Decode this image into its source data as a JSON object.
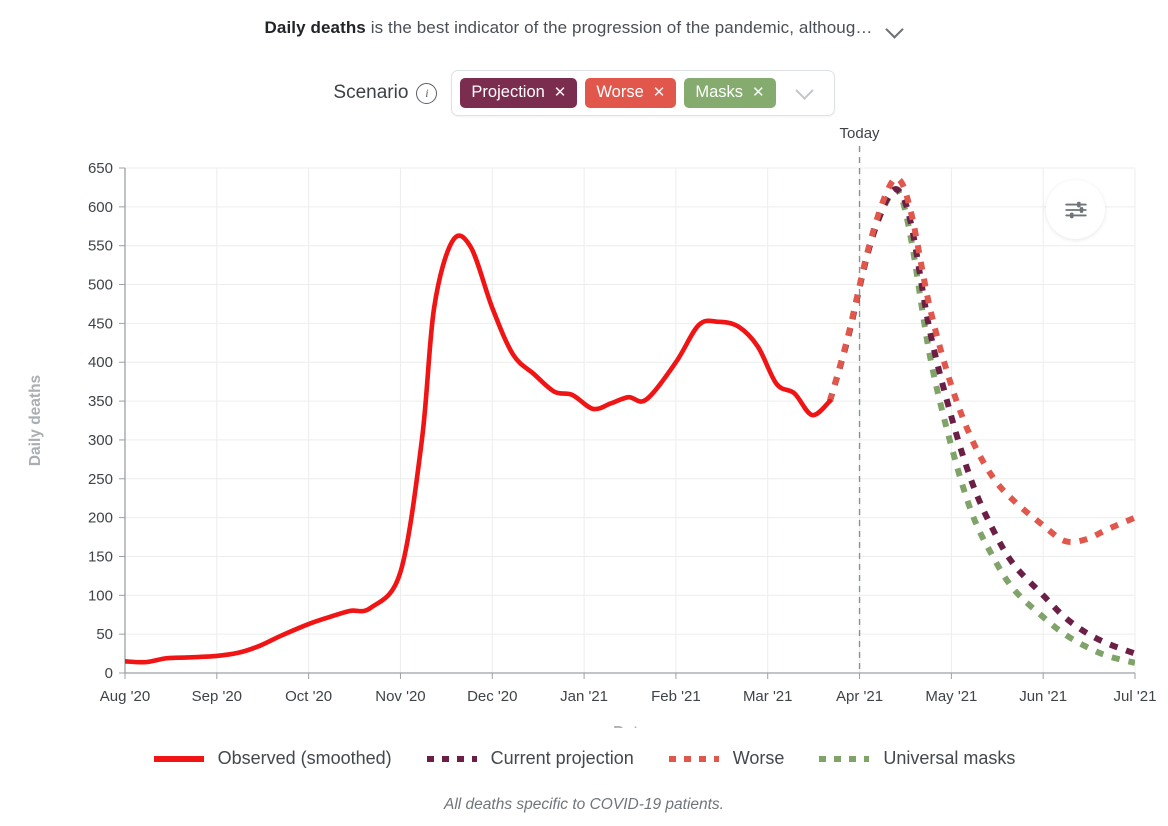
{
  "header": {
    "title_bold": "Daily deaths",
    "title_rest": " is the best indicator of the progression of the pandemic, althoug…",
    "expand_icon": "chevron-down-icon"
  },
  "scenario": {
    "label": "Scenario",
    "info_icon": "info-icon",
    "info_glyph": "i",
    "dropdown_icon": "chevron-down-icon",
    "tags": [
      {
        "label": "Projection",
        "color": "#7b2d50",
        "remove_icon": "close-icon",
        "remove_glyph": "✕"
      },
      {
        "label": "Worse",
        "color": "#e2574c",
        "remove_icon": "close-icon",
        "remove_glyph": "✕"
      },
      {
        "label": "Masks",
        "color": "#85ab6e",
        "remove_icon": "close-icon",
        "remove_glyph": "✕"
      }
    ]
  },
  "toolbar": {
    "settings_icon": "sliders-icon",
    "settings_label": "Chart settings"
  },
  "legend": [
    {
      "label": "Observed (smoothed)",
      "color": "#f01414",
      "style": "solid"
    },
    {
      "label": "Current projection",
      "color": "#6b1f45",
      "style": "dashed"
    },
    {
      "label": "Worse",
      "color": "#e2574c",
      "style": "dashed"
    },
    {
      "label": "Universal masks",
      "color": "#7fa368",
      "style": "dashed"
    }
  ],
  "footnote": "All deaths specific to COVID-19 patients.",
  "chart_data": {
    "type": "line",
    "title": "Daily deaths",
    "xlabel": "Date",
    "ylabel": "Daily deaths",
    "ylim": [
      0,
      650
    ],
    "ytick_step": 50,
    "ytick_labels": [
      "0",
      "50",
      "100",
      "150",
      "200",
      "250",
      "300",
      "350",
      "400",
      "450",
      "500",
      "550",
      "600",
      "650"
    ],
    "xtick_labels": [
      "Aug '20",
      "Sep '20",
      "Oct '20",
      "Nov '20",
      "Dec '20",
      "Jan '21",
      "Feb '21",
      "Mar '21",
      "Apr '21",
      "May '21",
      "Jun '21",
      "Jul '21"
    ],
    "xlim": [
      "Aug '20",
      "Jul '21"
    ],
    "grid": true,
    "legend_position": "bottom",
    "annotations": [
      {
        "name": "today-marker",
        "label": "Today",
        "x": "2021-04-01",
        "style": "dashed-vertical"
      }
    ],
    "series": [
      {
        "name": "Observed (smoothed)",
        "color": "#f01414",
        "style": "solid",
        "x": [
          "Aug 1",
          "Aug 8",
          "Aug 15",
          "Aug 22",
          "Sep 1",
          "Sep 8",
          "Sep 15",
          "Sep 22",
          "Oct 1",
          "Oct 8",
          "Oct 15",
          "Oct 22",
          "Nov 1",
          "Nov 8",
          "Nov 12",
          "Nov 18",
          "Nov 24",
          "Dec 1",
          "Dec 8",
          "Dec 15",
          "Dec 22",
          "Dec 28",
          "Jan 4",
          "Jan 10",
          "Jan 16",
          "Jan 22",
          "Feb 1",
          "Feb 8",
          "Feb 14",
          "Feb 20",
          "Feb 26",
          "Mar 4",
          "Mar 10",
          "Mar 16",
          "Mar 22"
        ],
        "values": [
          15,
          14,
          19,
          20,
          22,
          26,
          35,
          48,
          63,
          72,
          80,
          84,
          130,
          300,
          470,
          556,
          548,
          470,
          410,
          385,
          362,
          358,
          340,
          347,
          355,
          352,
          400,
          448,
          452,
          446,
          420,
          372,
          360,
          332,
          350
        ]
      },
      {
        "name": "Current projection",
        "color": "#6b1f45",
        "style": "dashed",
        "x": [
          "Mar 22",
          "Mar 28",
          "Apr 4",
          "Apr 10",
          "Apr 14",
          "Apr 18",
          "Apr 24",
          "May 1",
          "May 8",
          "May 15",
          "May 22",
          "Jun 1",
          "Jun 8",
          "Jun 15",
          "Jun 22",
          "Jul 1"
        ],
        "values": [
          350,
          430,
          545,
          610,
          620,
          575,
          440,
          330,
          245,
          185,
          140,
          100,
          72,
          52,
          38,
          25
        ]
      },
      {
        "name": "Worse",
        "color": "#e2574c",
        "style": "dashed",
        "x": [
          "Mar 22",
          "Mar 28",
          "Apr 4",
          "Apr 10",
          "Apr 14",
          "Apr 18",
          "Apr 24",
          "May 1",
          "May 8",
          "May 15",
          "May 22",
          "Jun 1",
          "Jun 8",
          "Jun 15",
          "Jun 22",
          "Jul 1"
        ],
        "values": [
          350,
          432,
          548,
          620,
          635,
          590,
          470,
          370,
          300,
          252,
          222,
          190,
          170,
          172,
          185,
          200
        ]
      },
      {
        "name": "Universal masks",
        "color": "#7fa368",
        "style": "dashed",
        "x": [
          "Mar 22",
          "Mar 28",
          "Apr 4",
          "Apr 10",
          "Apr 14",
          "Apr 18",
          "Apr 24",
          "May 1",
          "May 8",
          "May 15",
          "May 22",
          "Jun 1",
          "Jun 8",
          "Jun 15",
          "Jun 22",
          "Jul 1"
        ],
        "values": [
          350,
          430,
          545,
          608,
          618,
          555,
          408,
          292,
          205,
          150,
          108,
          72,
          50,
          34,
          22,
          13
        ]
      }
    ]
  }
}
